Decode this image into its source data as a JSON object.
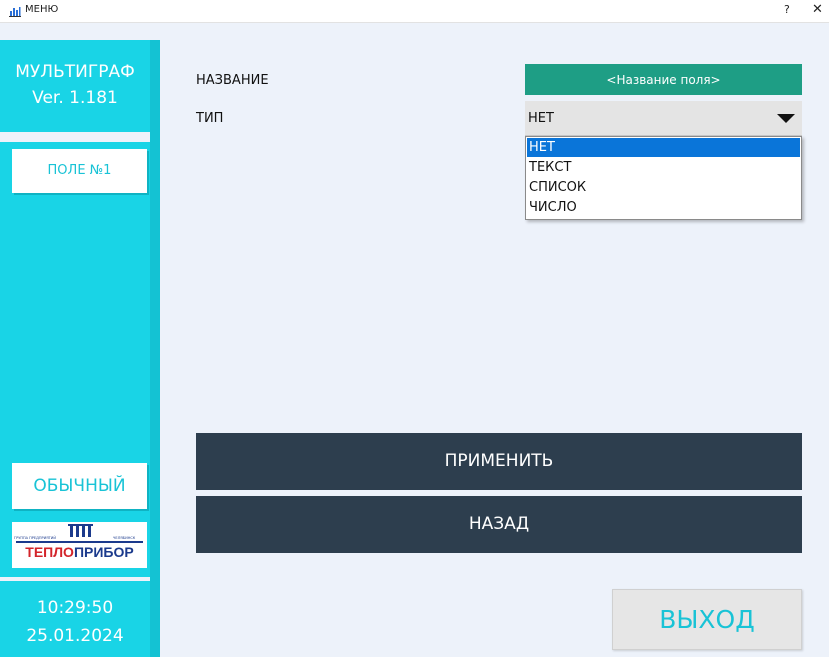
{
  "window": {
    "title": "МЕНЮ",
    "help_label": "?",
    "close_label": "✕",
    "icon": "chart-app-icon"
  },
  "sidebar": {
    "product_name": "МУЛЬТИГРАФ",
    "version": "Ver. 1.181",
    "field_button": "ПОЛЕ №1",
    "mode_button": "ОБЫЧНЫЙ",
    "logo": {
      "small_left": "ГРУППА ПРЕДПРИЯТИЙ",
      "small_right": "ЧЕЛЯБИНСК",
      "part1": "ТЕПЛО",
      "part2": "ПРИБОР"
    },
    "clock_time": "10:29:50",
    "clock_date": "25.01.2024"
  },
  "form": {
    "name_label": "НАЗВАНИЕ",
    "name_value": "<Название поля>",
    "type_label": "ТИП",
    "type_value": "НЕТ",
    "type_options": [
      "НЕТ",
      "ТЕКСТ",
      "СПИСОК",
      "ЧИСЛО"
    ],
    "type_selected_index": 0
  },
  "buttons": {
    "apply": "ПРИМЕНИТЬ",
    "back": "НАЗАД",
    "exit": "ВЫХОД"
  },
  "colors": {
    "sidebar": "#19d4e6",
    "name_field": "#1e9e85",
    "dark_button": "#2d3e4e",
    "selection": "#0a75d9",
    "accent_text": "#19c3d6"
  }
}
